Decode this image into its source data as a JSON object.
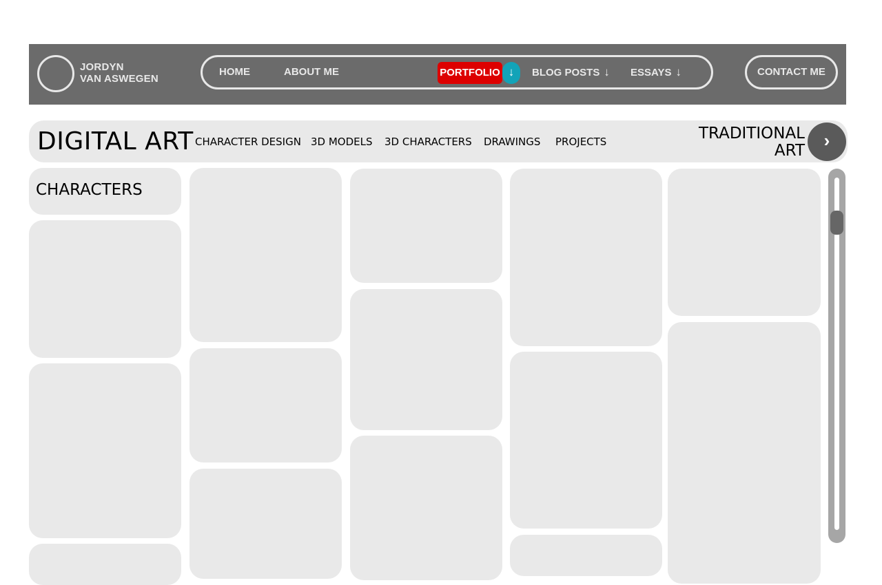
{
  "header": {
    "brand_line1": "JORDYN",
    "brand_line2": "VAN ASWEGEN",
    "nav": {
      "home": "HOME",
      "about": "ABOUT ME",
      "portfolio": "PORTFOLIO",
      "portfolio_arrow": "↓",
      "blog": "BLOG POSTS",
      "blog_arrow": "↓",
      "essays": "ESSAYS",
      "essays_arrow": "↓"
    },
    "contact": "CONTACT ME"
  },
  "subnav": {
    "title": "DIGITAL ART",
    "links": [
      "CHARACTER DESIGN",
      "3D MODELS",
      "3D CHARACTERS",
      "DRAWINGS",
      "PROJECTS"
    ],
    "next_section_line1": "TRADITIONAL",
    "next_section_line2": "ART",
    "next_icon": "›"
  },
  "gallery": {
    "section_label": "CHARACTERS"
  },
  "colors": {
    "header_bg": "#6b6b6b",
    "active_nav": "#dd0000",
    "dropdown_accent": "#12a3b8",
    "card_bg": "#e9e9e9",
    "next_button": "#5a5a5a"
  },
  "icons": {
    "logo": "logo-circle-icon",
    "dropdown": "arrow-down-icon",
    "next": "chevron-right-icon"
  }
}
